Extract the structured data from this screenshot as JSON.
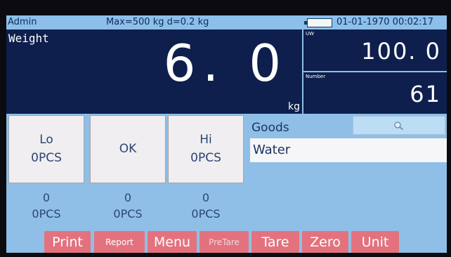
{
  "status_bar": {
    "user": "Admin",
    "capacity": "Max=500 kg d=0.2 kg",
    "datetime": "01-01-1970 00:02:17"
  },
  "weight": {
    "title": "Weight",
    "value": "6. 0",
    "unit": "kg"
  },
  "unit_weight": {
    "label": "UW",
    "value": "100. 0"
  },
  "count": {
    "label": "Number",
    "value": "61"
  },
  "check": {
    "lo": {
      "label": "Lo",
      "value": "0PCS"
    },
    "ok": {
      "label": "OK"
    },
    "hi": {
      "label": "Hi",
      "value": "0PCS"
    }
  },
  "counts": {
    "lo": {
      "count": "0",
      "pcs": "0PCS"
    },
    "ok": {
      "count": "0",
      "pcs": "0PCS"
    },
    "hi": {
      "count": "0",
      "pcs": "0PCS"
    }
  },
  "goods": {
    "label": "Goods",
    "name": "Water",
    "search_icon": "search-icon"
  },
  "function_keys": {
    "print": "Print",
    "report": "Report",
    "menu": "Menu",
    "pretare": "PreTare",
    "tare": "Tare",
    "zero": "Zero",
    "unit": "Unit"
  },
  "colors": {
    "status_bar": "#8cc0ea",
    "display_panel": "#0e1f4d",
    "function_key": "#e3727e",
    "text_blue": "#2c4575"
  }
}
